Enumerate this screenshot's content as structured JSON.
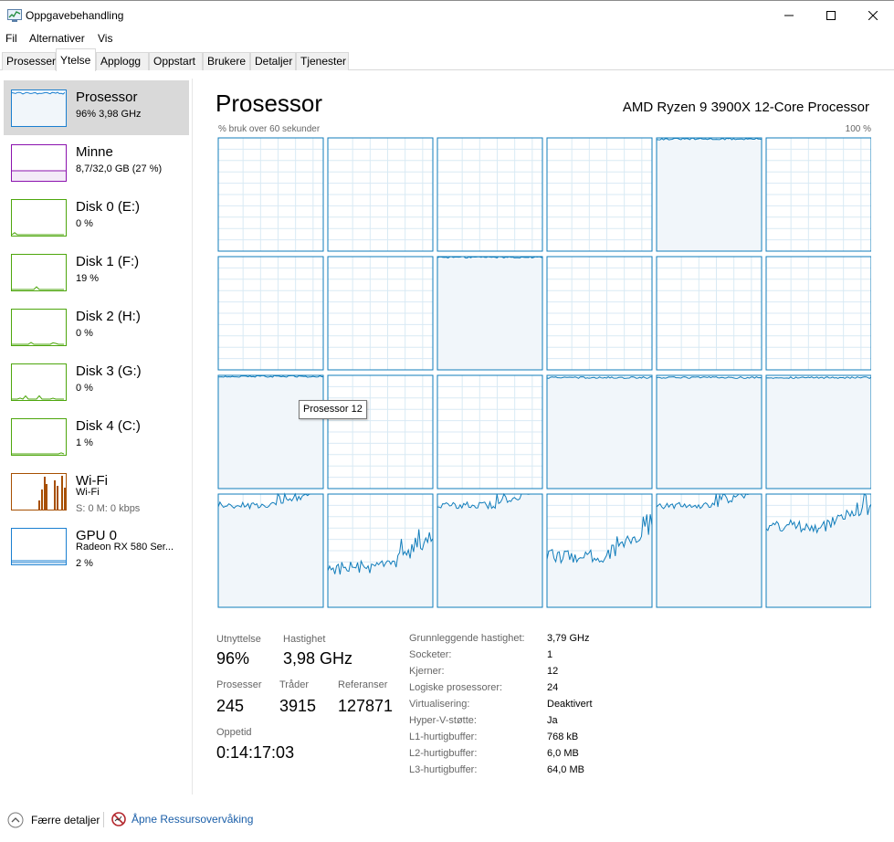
{
  "window": {
    "title": "Oppgavebehandling"
  },
  "menu": [
    "Fil",
    "Alternativer",
    "Vis"
  ],
  "tabs": [
    "Prosesser",
    "Ytelse",
    "Applogg",
    "Oppstart",
    "Brukere",
    "Detaljer",
    "Tjenester"
  ],
  "active_tab": "Ytelse",
  "sidebar": {
    "items": [
      {
        "title": "Prosessor",
        "sub": "96% 3,98 GHz",
        "color": "#1a7fd0"
      },
      {
        "title": "Minne",
        "sub": "8,7/32,0 GB (27 %)",
        "color": "#8b12ae"
      },
      {
        "title": "Disk 0 (E:)",
        "sub": "0 %",
        "color": "#4da60c"
      },
      {
        "title": "Disk 1 (F:)",
        "sub": "19 %",
        "color": "#4da60c"
      },
      {
        "title": "Disk 2 (H:)",
        "sub": "0 %",
        "color": "#4da60c"
      },
      {
        "title": "Disk 3 (G:)",
        "sub": "0 %",
        "color": "#4da60c"
      },
      {
        "title": "Disk 4 (C:)",
        "sub": "1 %",
        "color": "#4da60c"
      },
      {
        "title": "Wi-Fi",
        "sub": "Wi-Fi",
        "sub2": "S: 0 M: 0 kbps",
        "color": "#a74f01"
      },
      {
        "title": "GPU 0",
        "sub": "Radeon RX 580 Ser...",
        "sub2": "2 %",
        "color": "#1a7fd0"
      }
    ]
  },
  "main": {
    "title": "Prosessor",
    "cpu_model": "AMD Ryzen 9 3900X 12-Core Processor",
    "graph_caption": "% bruk over 60 sekunder",
    "graph_max": "100 %",
    "tooltip": "Prosessor 12",
    "graph_color": "#117dbb",
    "graph_fill": "#f1f6fa",
    "grid_color": "#d9eaf4"
  },
  "core_levels": [
    [
      0,
      0,
      0,
      0,
      0.99,
      0
    ],
    [
      0,
      0,
      0.995,
      0,
      0,
      0
    ],
    [
      0.99,
      0,
      0,
      0.98,
      0.98,
      0.98
    ],
    [
      0.9,
      0.35,
      0.9,
      0.45,
      0.9,
      0.72
    ]
  ],
  "stats": {
    "utilization_label": "Utnyttelse",
    "utilization": "96%",
    "speed_label": "Hastighet",
    "speed": "3,98 GHz",
    "processes_label": "Prosesser",
    "processes": "245",
    "threads_label": "Tråder",
    "threads": "3915",
    "handles_label": "Referanser",
    "handles": "127871",
    "uptime_label": "Oppetid",
    "uptime": "0:14:17:03"
  },
  "specs": [
    {
      "label": "Grunnleggende hastighet:",
      "value": "3,79 GHz"
    },
    {
      "label": "Socketer:",
      "value": "1"
    },
    {
      "label": "Kjerner:",
      "value": "12"
    },
    {
      "label": "Logiske prosessorer:",
      "value": "24"
    },
    {
      "label": "Virtualisering:",
      "value": "Deaktivert"
    },
    {
      "label": "Hyper-V-støtte:",
      "value": "Ja"
    },
    {
      "label": "L1-hurtigbuffer:",
      "value": "768 kB"
    },
    {
      "label": "L2-hurtigbuffer:",
      "value": "6,0 MB"
    },
    {
      "label": "L3-hurtigbuffer:",
      "value": "64,0 MB"
    }
  ],
  "footer": {
    "fewer_details": "Færre detaljer",
    "resource_monitor": "Åpne Ressursovervåking"
  }
}
